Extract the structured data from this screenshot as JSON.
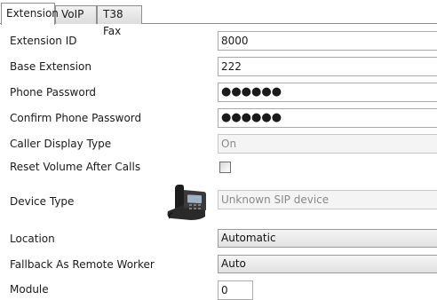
{
  "tabs": [
    {
      "label": "Extension",
      "active": true
    },
    {
      "label": "VoIP",
      "active": false
    },
    {
      "label": "T38 Fax",
      "active": false
    }
  ],
  "form": {
    "extension_id": {
      "label": "Extension ID",
      "value": "8000"
    },
    "base_extension": {
      "label": "Base Extension",
      "value": "222"
    },
    "phone_password": {
      "label": "Phone Password",
      "value": "●●●●●●"
    },
    "confirm_phone_password": {
      "label": "Confirm Phone Password",
      "value": "●●●●●●"
    },
    "caller_display_type": {
      "label": "Caller Display Type",
      "value": "On"
    },
    "reset_volume_after_calls": {
      "label": "Reset Volume After Calls",
      "checked": false
    },
    "device_type": {
      "label": "Device Type",
      "value": "Unknown SIP device",
      "icon": "desk-phone-icon"
    },
    "location": {
      "label": "Location",
      "value": "Automatic"
    },
    "fallback_as_remote_worker": {
      "label": "Fallback As Remote Worker",
      "value": "Auto"
    },
    "module": {
      "label": "Module",
      "value": "0"
    }
  }
}
